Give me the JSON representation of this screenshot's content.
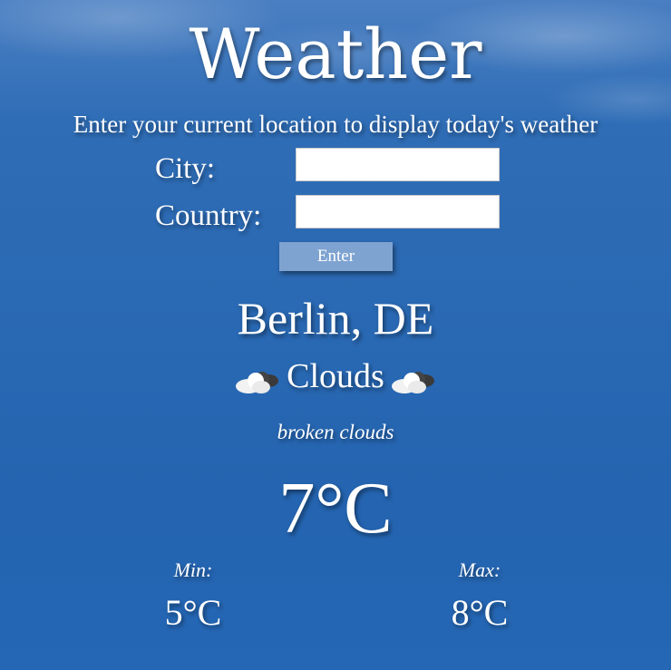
{
  "header": {
    "title": "Weather",
    "subtitle": "Enter your current location to display today's weather"
  },
  "form": {
    "city_label": "City:",
    "city_value": "",
    "country_label": "Country:",
    "country_value": "",
    "enter_label": "Enter"
  },
  "result": {
    "location": "Berlin, DE",
    "condition": "Clouds",
    "condition_icon": "cloud-sun-icon",
    "description": "broken clouds",
    "temperature": "7°C",
    "min_label": "Min:",
    "min_value": "5°C",
    "max_label": "Max:",
    "max_value": "8°C"
  },
  "colors": {
    "background": "#2567b4",
    "button": "#7fa3d1",
    "text": "#ffffff"
  }
}
